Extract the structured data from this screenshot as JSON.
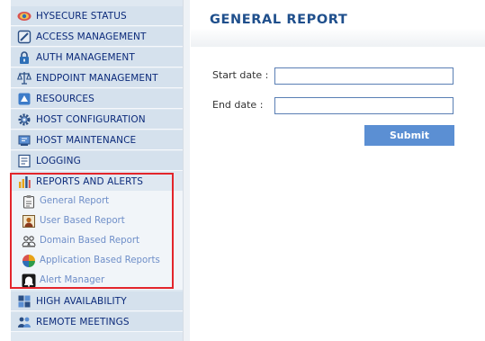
{
  "sidebar": {
    "items": [
      {
        "label": "HYSECURE STATUS",
        "icon": "eye-status-icon"
      },
      {
        "label": "ACCESS MANAGEMENT",
        "icon": "access-management-icon"
      },
      {
        "label": "AUTH MANAGEMENT",
        "icon": "lock-icon"
      },
      {
        "label": "ENDPOINT MANAGEMENT",
        "icon": "scales-icon"
      },
      {
        "label": "RESOURCES",
        "icon": "resources-icon"
      },
      {
        "label": "HOST CONFIGURATION",
        "icon": "gear-icon"
      },
      {
        "label": "HOST MAINTENANCE",
        "icon": "maintenance-icon"
      },
      {
        "label": "LOGGING",
        "icon": "logging-icon"
      },
      {
        "label": "REPORTS AND ALERTS",
        "icon": "bar-chart-icon"
      },
      {
        "label": "HIGH AVAILABILITY",
        "icon": "high-availability-icon"
      },
      {
        "label": "REMOTE MEETINGS",
        "icon": "remote-meetings-icon"
      }
    ],
    "reports_submenu": [
      {
        "label": "General Report",
        "icon": "clipboard-icon"
      },
      {
        "label": "User Based Report",
        "icon": "user-report-icon"
      },
      {
        "label": "Domain Based Report",
        "icon": "domain-report-icon"
      },
      {
        "label": "Application Based Reports",
        "icon": "pie-chart-icon"
      },
      {
        "label": "Alert Manager",
        "icon": "bell-icon"
      }
    ]
  },
  "main": {
    "title": "GENERAL REPORT",
    "start_date_label": "Start date :",
    "end_date_label": "End date :",
    "start_date_value": "",
    "end_date_value": "",
    "submit_label": "Submit"
  },
  "colors": {
    "highlight": "#e3252b",
    "menu_text": "#0b2a7a",
    "submenu_text": "#6e8ec8",
    "title": "#1f4f8c",
    "button": "#5b8fd3"
  }
}
